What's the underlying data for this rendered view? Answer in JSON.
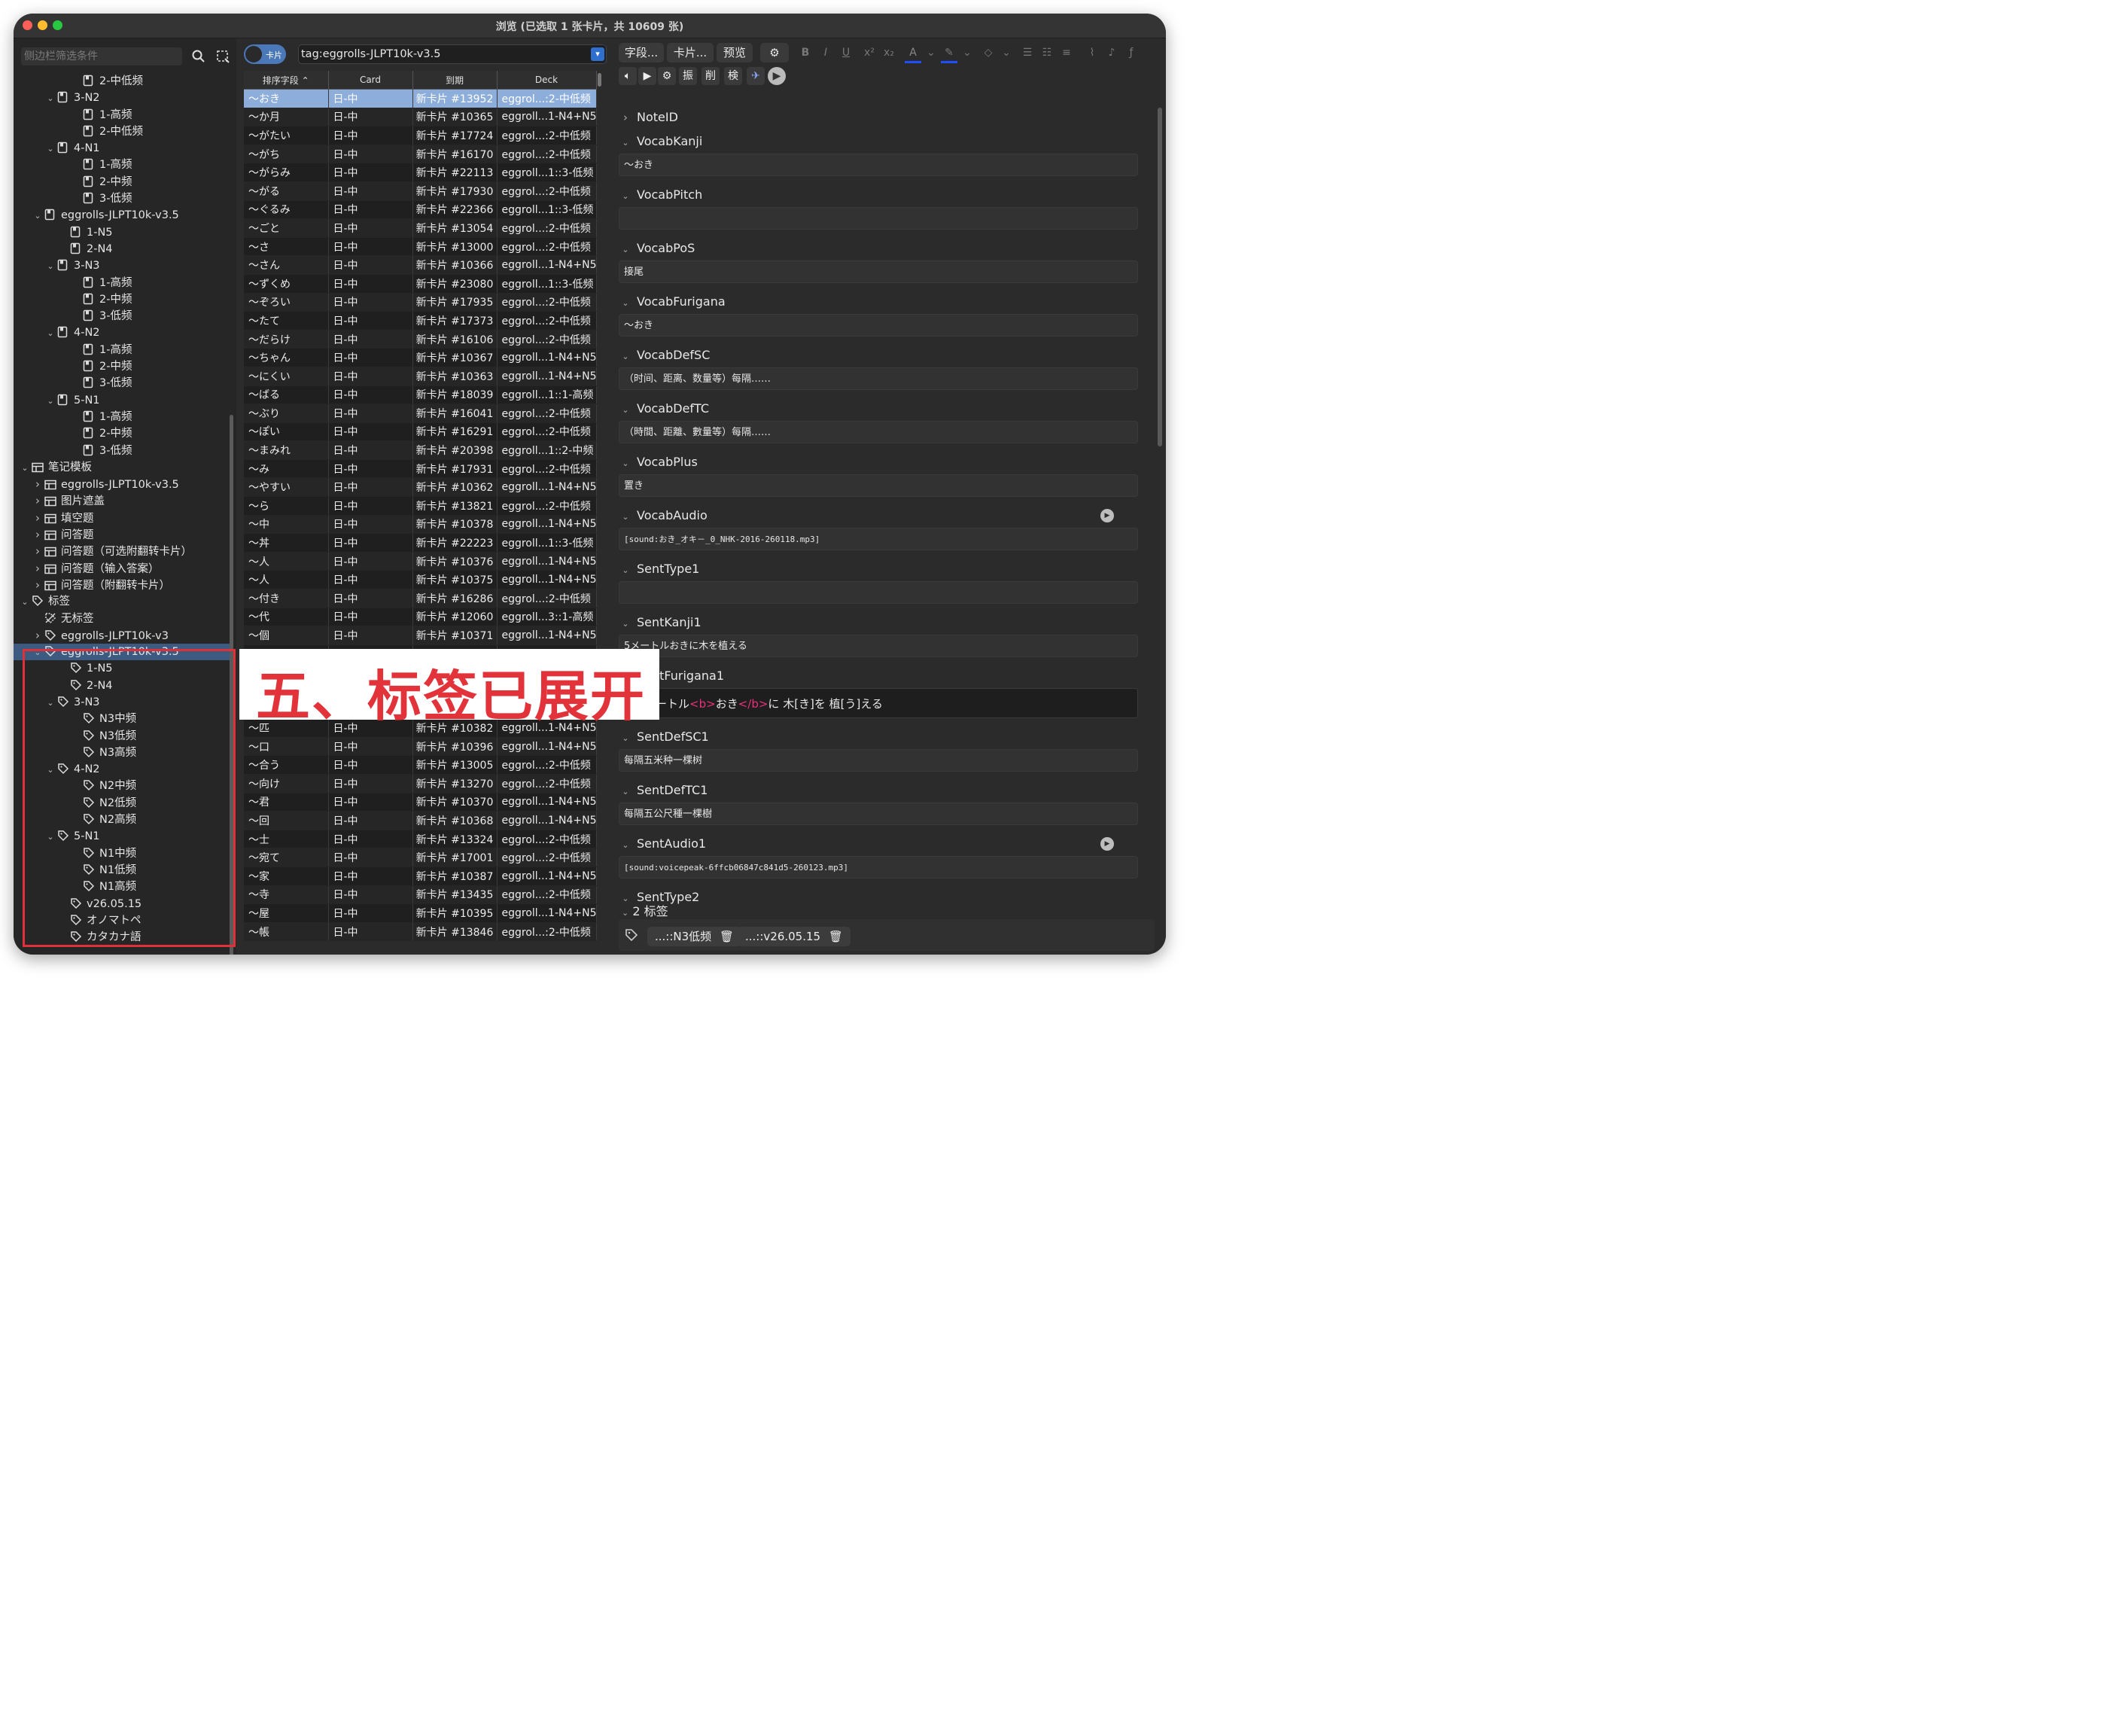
{
  "window": {
    "title": "浏览 (已选取 1 张卡片，共 10609 张)"
  },
  "sidebar": {
    "search_placeholder": "侧边栏筛选条件",
    "tree": [
      {
        "indent": 5,
        "icon": "deck",
        "chev": "",
        "label": "2-中低频"
      },
      {
        "indent": 3,
        "icon": "deck",
        "chev": "v",
        "label": "3-N2"
      },
      {
        "indent": 5,
        "icon": "deck",
        "chev": "",
        "label": "1-高频"
      },
      {
        "indent": 5,
        "icon": "deck",
        "chev": "",
        "label": "2-中低频"
      },
      {
        "indent": 3,
        "icon": "deck",
        "chev": "v",
        "label": "4-N1"
      },
      {
        "indent": 5,
        "icon": "deck",
        "chev": "",
        "label": "1-高频"
      },
      {
        "indent": 5,
        "icon": "deck",
        "chev": "",
        "label": "2-中频"
      },
      {
        "indent": 5,
        "icon": "deck",
        "chev": "",
        "label": "3-低频"
      },
      {
        "indent": 2,
        "icon": "deck",
        "chev": "v",
        "label": "eggrolls-JLPT10k-v3.5"
      },
      {
        "indent": 4,
        "icon": "deck",
        "chev": "",
        "label": "1-N5"
      },
      {
        "indent": 4,
        "icon": "deck",
        "chev": "",
        "label": "2-N4"
      },
      {
        "indent": 3,
        "icon": "deck",
        "chev": "v",
        "label": "3-N3"
      },
      {
        "indent": 5,
        "icon": "deck",
        "chev": "",
        "label": "1-高频"
      },
      {
        "indent": 5,
        "icon": "deck",
        "chev": "",
        "label": "2-中频"
      },
      {
        "indent": 5,
        "icon": "deck",
        "chev": "",
        "label": "3-低频"
      },
      {
        "indent": 3,
        "icon": "deck",
        "chev": "v",
        "label": "4-N2"
      },
      {
        "indent": 5,
        "icon": "deck",
        "chev": "",
        "label": "1-高频"
      },
      {
        "indent": 5,
        "icon": "deck",
        "chev": "",
        "label": "2-中频"
      },
      {
        "indent": 5,
        "icon": "deck",
        "chev": "",
        "label": "3-低频"
      },
      {
        "indent": 3,
        "icon": "deck",
        "chev": "v",
        "label": "5-N1"
      },
      {
        "indent": 5,
        "icon": "deck",
        "chev": "",
        "label": "1-高频"
      },
      {
        "indent": 5,
        "icon": "deck",
        "chev": "",
        "label": "2-中频"
      },
      {
        "indent": 5,
        "icon": "deck",
        "chev": "",
        "label": "3-低频"
      },
      {
        "indent": 1,
        "icon": "notetype",
        "chev": "v",
        "label": "笔记模板"
      },
      {
        "indent": 2,
        "icon": "notetype",
        "chev": ">",
        "label": "eggrolls-JLPT10k-v3.5"
      },
      {
        "indent": 2,
        "icon": "notetype",
        "chev": ">",
        "label": "图片遮盖"
      },
      {
        "indent": 2,
        "icon": "notetype",
        "chev": ">",
        "label": "填空题"
      },
      {
        "indent": 2,
        "icon": "notetype",
        "chev": ">",
        "label": "问答题"
      },
      {
        "indent": 2,
        "icon": "notetype",
        "chev": ">",
        "label": "问答题（可选附翻转卡片）"
      },
      {
        "indent": 2,
        "icon": "notetype",
        "chev": ">",
        "label": "问答题（输入答案）"
      },
      {
        "indent": 2,
        "icon": "notetype",
        "chev": ">",
        "label": "问答题（附翻转卡片）"
      },
      {
        "indent": 1,
        "icon": "tag",
        "chev": "v",
        "label": "标签"
      },
      {
        "indent": 2,
        "icon": "notag",
        "chev": "",
        "label": "无标签"
      },
      {
        "indent": 2,
        "icon": "tag",
        "chev": ">",
        "label": "eggrolls-JLPT10k-v3"
      },
      {
        "indent": 2,
        "icon": "tag",
        "chev": "v",
        "label": "eggrolls-JLPT10k-v3.5",
        "selected": true
      },
      {
        "indent": 4,
        "icon": "tag",
        "chev": "",
        "label": "1-N5"
      },
      {
        "indent": 4,
        "icon": "tag",
        "chev": "",
        "label": "2-N4"
      },
      {
        "indent": 3,
        "icon": "tag",
        "chev": "v",
        "label": "3-N3"
      },
      {
        "indent": 5,
        "icon": "tag",
        "chev": "",
        "label": "N3中频"
      },
      {
        "indent": 5,
        "icon": "tag",
        "chev": "",
        "label": "N3低频"
      },
      {
        "indent": 5,
        "icon": "tag",
        "chev": "",
        "label": "N3高频"
      },
      {
        "indent": 3,
        "icon": "tag",
        "chev": "v",
        "label": "4-N2"
      },
      {
        "indent": 5,
        "icon": "tag",
        "chev": "",
        "label": "N2中频"
      },
      {
        "indent": 5,
        "icon": "tag",
        "chev": "",
        "label": "N2低频"
      },
      {
        "indent": 5,
        "icon": "tag",
        "chev": "",
        "label": "N2高频"
      },
      {
        "indent": 3,
        "icon": "tag",
        "chev": "v",
        "label": "5-N1"
      },
      {
        "indent": 5,
        "icon": "tag",
        "chev": "",
        "label": "N1中频"
      },
      {
        "indent": 5,
        "icon": "tag",
        "chev": "",
        "label": "N1低频"
      },
      {
        "indent": 5,
        "icon": "tag",
        "chev": "",
        "label": "N1高频"
      },
      {
        "indent": 4,
        "icon": "tag",
        "chev": "",
        "label": "v26.05.15"
      },
      {
        "indent": 4,
        "icon": "tag",
        "chev": "",
        "label": "オノマトペ"
      },
      {
        "indent": 4,
        "icon": "tag",
        "chev": "",
        "label": "カタカナ語"
      }
    ]
  },
  "browser": {
    "toggle_label": "卡片",
    "query": "tag:eggrolls-JLPT10k-v3.5",
    "columns": [
      "排序字段",
      "Card",
      "到期",
      "Deck"
    ],
    "rows": [
      [
        "～おき",
        "日-中",
        "新卡片 #13952",
        "eggrol...:2-中低频"
      ],
      [
        "～か月",
        "日-中",
        "新卡片 #10365",
        "eggroll...1-N4+N5"
      ],
      [
        "～がたい",
        "日-中",
        "新卡片 #17724",
        "eggrol...:2-中低频"
      ],
      [
        "～がち",
        "日-中",
        "新卡片 #16170",
        "eggrol...:2-中低频"
      ],
      [
        "～がらみ",
        "日-中",
        "新卡片 #22113",
        "eggroll...1::3-低频"
      ],
      [
        "～がる",
        "日-中",
        "新卡片 #17930",
        "eggrol...:2-中低频"
      ],
      [
        "～ぐるみ",
        "日-中",
        "新卡片 #22366",
        "eggroll...1::3-低频"
      ],
      [
        "～ごと",
        "日-中",
        "新卡片 #13054",
        "eggrol...:2-中低频"
      ],
      [
        "～さ",
        "日-中",
        "新卡片 #13000",
        "eggrol...:2-中低频"
      ],
      [
        "～さん",
        "日-中",
        "新卡片 #10366",
        "eggroll...1-N4+N5"
      ],
      [
        "～ずくめ",
        "日-中",
        "新卡片 #23080",
        "eggroll...1::3-低频"
      ],
      [
        "～ぞろい",
        "日-中",
        "新卡片 #17935",
        "eggrol...:2-中低频"
      ],
      [
        "～たて",
        "日-中",
        "新卡片 #17373",
        "eggrol...:2-中低频"
      ],
      [
        "～だらけ",
        "日-中",
        "新卡片 #16106",
        "eggrol...:2-中低频"
      ],
      [
        "～ちゃん",
        "日-中",
        "新卡片 #10367",
        "eggroll...1-N4+N5"
      ],
      [
        "～にくい",
        "日-中",
        "新卡片 #10363",
        "eggroll...1-N4+N5"
      ],
      [
        "～ばる",
        "日-中",
        "新卡片 #18039",
        "eggroll...1::1-高频"
      ],
      [
        "～ぶり",
        "日-中",
        "新卡片 #16041",
        "eggrol...:2-中低频"
      ],
      [
        "～ぽい",
        "日-中",
        "新卡片 #16291",
        "eggrol...:2-中低频"
      ],
      [
        "～まみれ",
        "日-中",
        "新卡片 #20398",
        "eggroll...1::2-中频"
      ],
      [
        "～み",
        "日-中",
        "新卡片 #17931",
        "eggrol...:2-中低频"
      ],
      [
        "～やすい",
        "日-中",
        "新卡片 #10362",
        "eggroll...1-N4+N5"
      ],
      [
        "～ら",
        "日-中",
        "新卡片 #13821",
        "eggrol...:2-中低频"
      ],
      [
        "～中",
        "日-中",
        "新卡片 #10378",
        "eggroll...1-N4+N5"
      ],
      [
        "～丼",
        "日-中",
        "新卡片 #22223",
        "eggroll...1::3-低频"
      ],
      [
        "～人",
        "日-中",
        "新卡片 #10376",
        "eggroll...1-N4+N5"
      ],
      [
        "～人",
        "日-中",
        "新卡片 #10375",
        "eggroll...1-N4+N5"
      ],
      [
        "～付き",
        "日-中",
        "新卡片 #16286",
        "eggrol...:2-中低频"
      ],
      [
        "～代",
        "日-中",
        "新卡片 #12060",
        "eggroll...3::1-高频"
      ],
      [
        "～個",
        "日-中",
        "新卡片 #10371",
        "eggroll...1-N4+N5"
      ],
      [
        "",
        "",
        "",
        ""
      ],
      [
        "",
        "",
        "",
        ""
      ],
      [
        "",
        "",
        "",
        ""
      ],
      [
        "",
        "",
        "",
        ""
      ],
      [
        "～匹",
        "日-中",
        "新卡片 #10382",
        "eggroll...1-N4+N5"
      ],
      [
        "～口",
        "日-中",
        "新卡片 #10396",
        "eggroll...1-N4+N5"
      ],
      [
        "～合う",
        "日-中",
        "新卡片 #13005",
        "eggrol...:2-中低频"
      ],
      [
        "～向け",
        "日-中",
        "新卡片 #13270",
        "eggrol...:2-中低频"
      ],
      [
        "～君",
        "日-中",
        "新卡片 #10370",
        "eggroll...1-N4+N5"
      ],
      [
        "～回",
        "日-中",
        "新卡片 #10368",
        "eggroll...1-N4+N5"
      ],
      [
        "～士",
        "日-中",
        "新卡片 #13324",
        "eggrol...:2-中低频"
      ],
      [
        "～宛て",
        "日-中",
        "新卡片 #17001",
        "eggrol...:2-中低频"
      ],
      [
        "～家",
        "日-中",
        "新卡片 #10387",
        "eggroll...1-N4+N5"
      ],
      [
        "～寺",
        "日-中",
        "新卡片 #13435",
        "eggrol...:2-中低频"
      ],
      [
        "～屋",
        "日-中",
        "新卡片 #10395",
        "eggroll...1-N4+N5"
      ],
      [
        "～帳",
        "日-中",
        "新卡片 #13846",
        "eggrol...:2-中低频"
      ]
    ]
  },
  "editor": {
    "toolbar": {
      "fields_btn": "字段...",
      "cards_btn": "卡片...",
      "preview_btn": "预览"
    },
    "mini_buttons": [
      "振",
      "削",
      "検"
    ],
    "fields": [
      {
        "name": "NoteID",
        "collapsed": true,
        "value": null
      },
      {
        "name": "VocabKanji",
        "value": "～おき"
      },
      {
        "name": "VocabPitch",
        "value": ""
      },
      {
        "name": "VocabPoS",
        "value": "接尾"
      },
      {
        "name": "VocabFurigana",
        "value": "～おき"
      },
      {
        "name": "VocabDefSC",
        "value": "（时间、距离、数量等）每隔……"
      },
      {
        "name": "VocabDefTC",
        "value": "（時間、距離、數量等）每隔……"
      },
      {
        "name": "VocabPlus",
        "value": "置き"
      },
      {
        "name": "VocabAudio",
        "value": "[sound:おき_オキ－_0_NHK-2016-260118.mp3]",
        "mono": true,
        "play": true
      },
      {
        "name": "SentType1",
        "value": ""
      },
      {
        "name": "SentKanji1",
        "value": "5メートルおきに木を植える"
      },
      {
        "name": "SentFurigana1",
        "value": "ートル<b>おき</b>に 木[き]を 植[う]える",
        "html": true
      },
      {
        "name": "SentDefSC1",
        "value": "每隔五米种一棵树"
      },
      {
        "name": "SentDefTC1",
        "value": "每隔五公尺種一棵樹"
      },
      {
        "name": "SentAudio1",
        "value": "[sound:voicepeak-6ffcb06847c841d5-260123.mp3]",
        "mono": true,
        "play": true
      },
      {
        "name": "SentType2",
        "value": null
      }
    ],
    "tags_header": "2 标签",
    "tags": [
      "...::N3低频",
      "...::v26.05.15"
    ]
  },
  "annotation": {
    "banner_text": "五、标签已展开",
    "accent": "#e2323a"
  }
}
